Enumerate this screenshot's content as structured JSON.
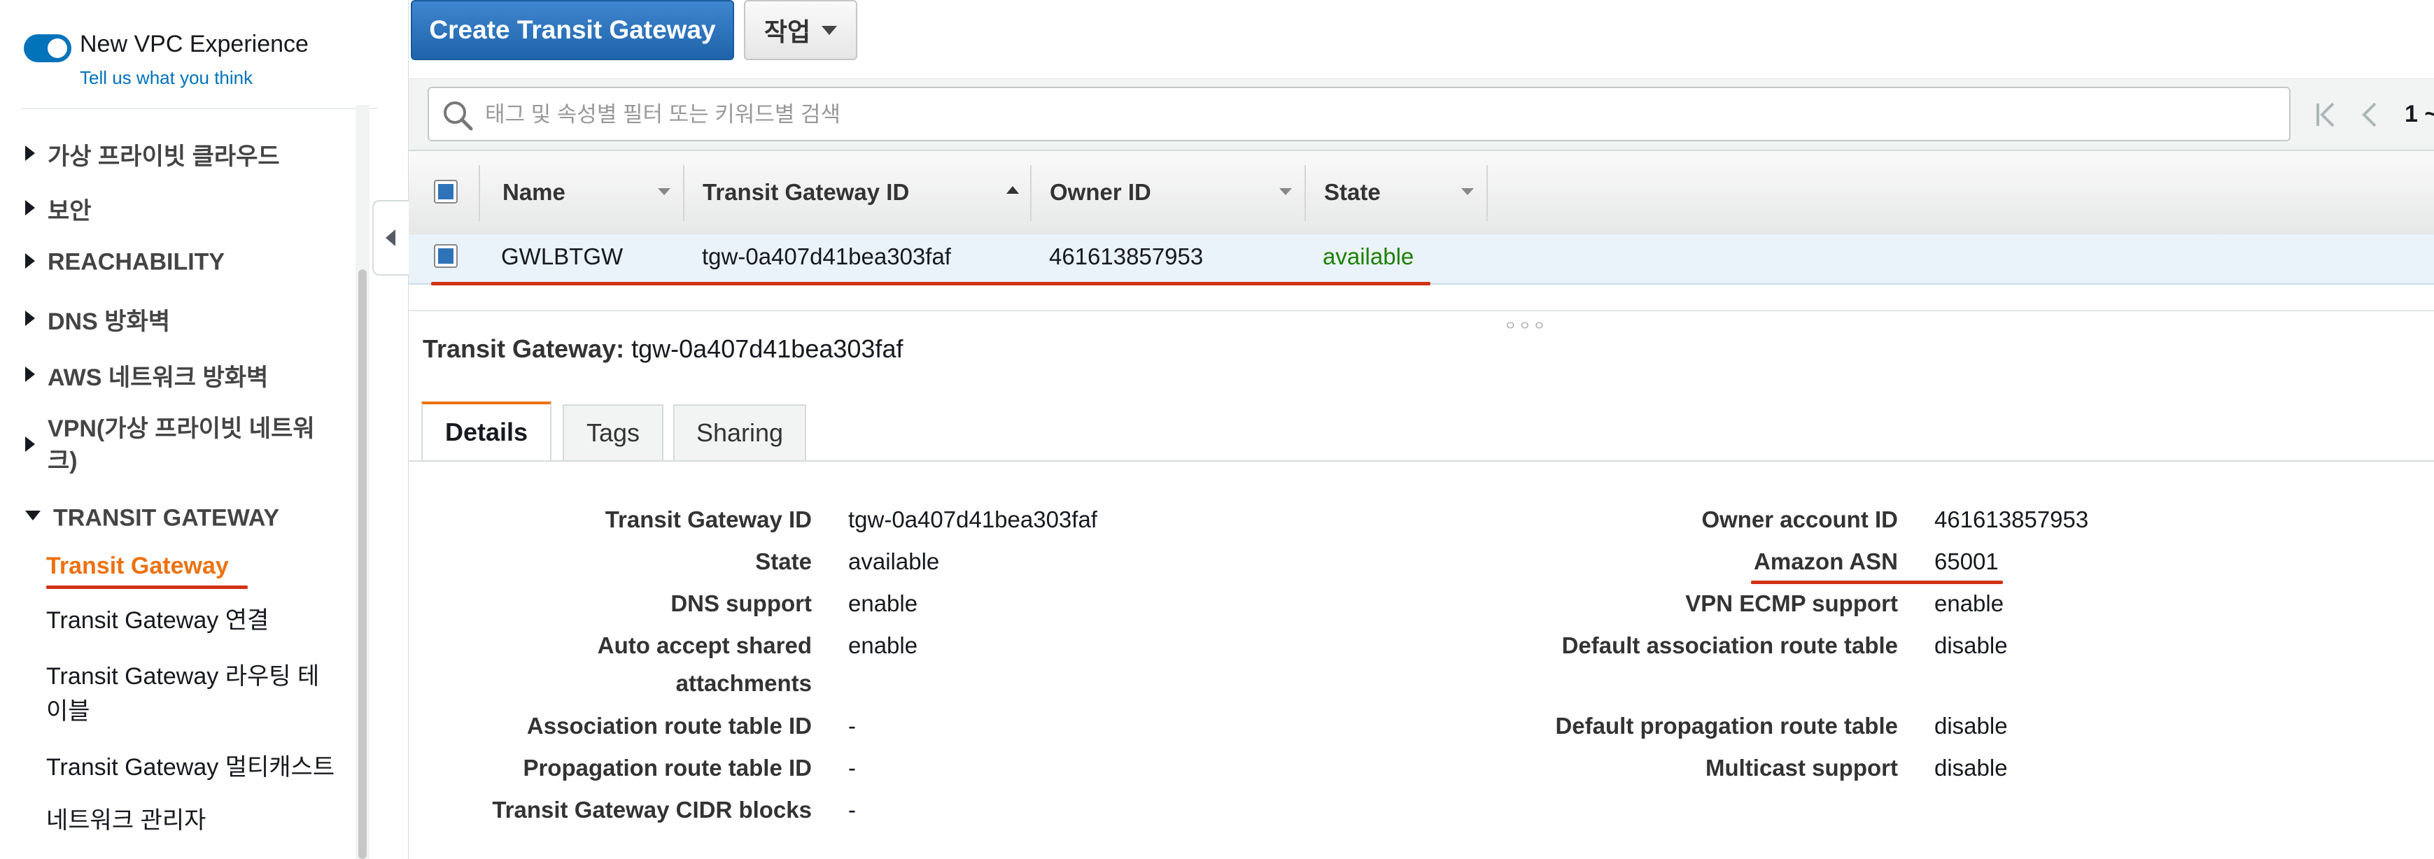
{
  "sidebar": {
    "new_vpc_title": "New VPC Experience",
    "feedback_link": "Tell us what you think",
    "sections": [
      {
        "label": "가상 프라이빗 클라우드"
      },
      {
        "label": "보안"
      },
      {
        "label": "REACHABILITY"
      },
      {
        "label": "DNS 방화벽"
      },
      {
        "label": "AWS 네트워크 방화벽"
      },
      {
        "label": "VPN(가상 프라이빗 네트워\n크)"
      },
      {
        "label": "TRANSIT GATEWAY"
      }
    ],
    "items": [
      {
        "label": "Transit Gateway"
      },
      {
        "label": "Transit Gateway 연결"
      },
      {
        "label": "Transit Gateway 라우팅 테\n이블"
      },
      {
        "label": "Transit Gateway 멀티캐스트"
      },
      {
        "label": "네트워크 관리자"
      }
    ]
  },
  "toolbar": {
    "create_label": "Create Transit Gateway",
    "actions_label": "작업"
  },
  "search": {
    "placeholder": "태그 및 속성별 필터 또는 키워드별 검색"
  },
  "pagination": {
    "page": "1 ~"
  },
  "table": {
    "columns": [
      "Name",
      "Transit Gateway ID",
      "Owner ID",
      "State"
    ],
    "rows": [
      {
        "name": "GWLBTGW",
        "id": "tgw-0a407d41bea303faf",
        "owner": "461613857953",
        "state": "available"
      }
    ]
  },
  "detail": {
    "title_label": "Transit Gateway:",
    "title_value": "tgw-0a407d41bea303faf",
    "tabs": [
      "Details",
      "Tags",
      "Sharing"
    ],
    "left": [
      {
        "label": "Transit Gateway ID",
        "value": "tgw-0a407d41bea303faf"
      },
      {
        "label": "State",
        "value": "available"
      },
      {
        "label": "DNS support",
        "value": "enable"
      },
      {
        "label": "Auto accept shared\nattachments",
        "value": "enable"
      },
      {
        "label": "Association route table ID",
        "value": "-"
      },
      {
        "label": "Propagation route table ID",
        "value": "-"
      },
      {
        "label": "Transit Gateway CIDR blocks",
        "value": "-"
      }
    ],
    "right": [
      {
        "label": "Owner account ID",
        "value": "461613857953"
      },
      {
        "label": "Amazon ASN",
        "value": "65001"
      },
      {
        "label": "VPN ECMP support",
        "value": "enable"
      },
      {
        "label": "Default association route table",
        "value": "disable"
      },
      {
        "label": "Default propagation route table",
        "value": "disable"
      },
      {
        "label": "Multicast support",
        "value": "disable"
      }
    ]
  },
  "colors": {
    "primary_button": "#2e73b8",
    "active_nav": "#ec7211",
    "available_green": "#1d8102",
    "annotation_red": "#d13212"
  }
}
